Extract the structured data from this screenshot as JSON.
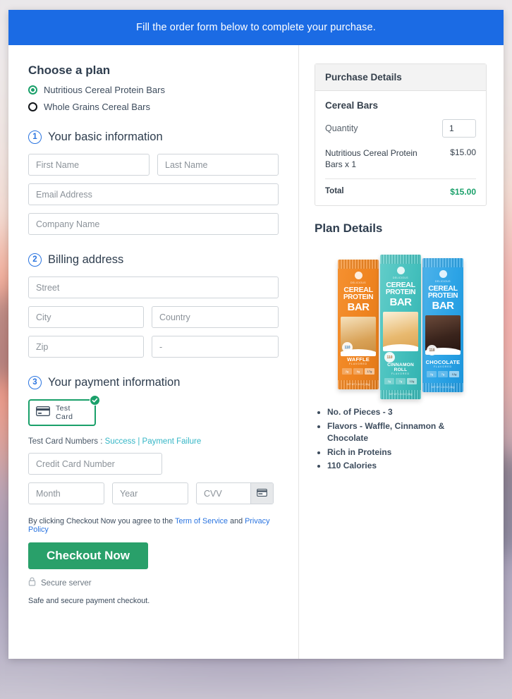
{
  "banner": {
    "text": "Fill the order form below to complete your purchase."
  },
  "plan": {
    "title": "Choose a plan",
    "options": [
      {
        "label": "Nutritious Cereal Protein Bars",
        "selected": true
      },
      {
        "label": "Whole Grains Cereal Bars",
        "selected": false
      }
    ]
  },
  "steps": [
    {
      "number": "1",
      "label": "Your basic information"
    },
    {
      "number": "2",
      "label": "Billing address"
    },
    {
      "number": "3",
      "label": "Your payment information"
    }
  ],
  "basic_info": {
    "first_name_placeholder": "First Name",
    "last_name_placeholder": "Last Name",
    "email_placeholder": "Email Address",
    "company_placeholder": "Company Name"
  },
  "billing": {
    "street_placeholder": "Street",
    "city_placeholder": "City",
    "country_placeholder": "Country",
    "zip_placeholder": "Zip",
    "state_placeholder": "-"
  },
  "payment": {
    "method_label": "Test Card",
    "test_cards_prefix": "Test Card Numbers :",
    "test_success": "Success",
    "test_separator": "|",
    "test_failure": "Payment Failure",
    "card_number_placeholder": "Credit Card Number",
    "month_placeholder": "Month",
    "year_placeholder": "Year",
    "cvv_placeholder": "CVV"
  },
  "terms": {
    "prefix": "By clicking Checkout Now you agree to the",
    "tos": "Term of Service",
    "conjunction": "and",
    "privacy": "Privacy Policy"
  },
  "checkout": {
    "button_label": "Checkout Now",
    "secure_label": "Secure server",
    "footer_note": "Safe and secure payment checkout."
  },
  "purchase_details": {
    "header": "Purchase Details",
    "product_name": "Cereal Bars",
    "quantity_label": "Quantity",
    "quantity_value": "1",
    "line_item_name": "Nutritious Cereal Protein Bars x 1",
    "line_item_amount": "$15.00",
    "total_label": "Total",
    "total_amount": "$15.00"
  },
  "plan_details": {
    "title": "Plan Details",
    "product_bars": [
      {
        "brand_line1": "CEREAL",
        "brand_line2": "PROTEIN",
        "brand_line3": "BAR",
        "flavor": "WAFFLE",
        "flavor_sub": "FLAVORED",
        "calories": "110",
        "nutrition": [
          "2g",
          "6g",
          "17g"
        ],
        "net_weight": "NET WT 1.34 OZ (38g)",
        "eyebrow": "DELICIOUS"
      },
      {
        "brand_line1": "CEREAL",
        "brand_line2": "PROTEIN",
        "brand_line3": "BAR",
        "flavor": "CINNAMON ROLL",
        "flavor_sub": "FLAVORED",
        "calories": "110",
        "nutrition": [
          "2g",
          "7g",
          "12g"
        ],
        "net_weight": "NET WT 1.34 OZ (38g)",
        "eyebrow": "DELICIOUS"
      },
      {
        "brand_line1": "CEREAL",
        "brand_line2": "PROTEIN",
        "brand_line3": "BAR",
        "flavor": "CHOCOLATE",
        "flavor_sub": "FLAVORED",
        "calories": "110",
        "nutrition": [
          "2g",
          "7g",
          "12g"
        ],
        "net_weight": "NET WT 1.34 OZ (38g)",
        "eyebrow": "DELICIOUS"
      }
    ],
    "bullets": [
      "No. of Pieces - 3",
      "Flavors - Waffle, Cinnamon & Chocolate",
      "Rich in Proteins",
      "110 Calories"
    ]
  },
  "colors": {
    "banner_blue": "#1b6be4",
    "accent_blue": "#2a74e0",
    "success_green": "#1aa06a",
    "checkout_green": "#29a06a",
    "link_teal": "#35b6c6"
  }
}
